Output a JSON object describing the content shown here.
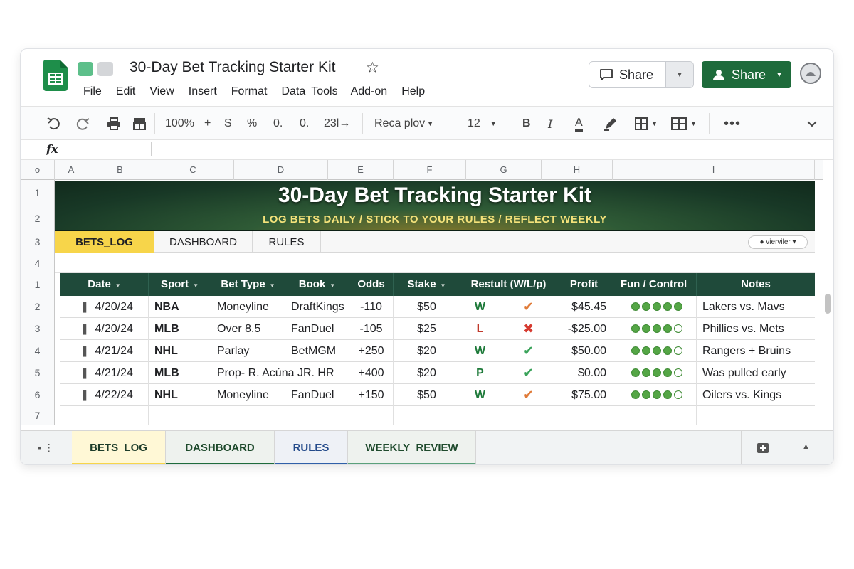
{
  "document": {
    "title": "30-Day Bet Tracking Starter Kit",
    "star_icon": "star-icon"
  },
  "menu": [
    "File",
    "Edit",
    "View",
    "Insert",
    "Format",
    "Data",
    "Tools",
    "Add-on",
    "Help"
  ],
  "share": {
    "outline_label": "Share",
    "primary_label": "Share"
  },
  "toolbar": {
    "zoom": "100%",
    "plus": "+",
    "currency": "S",
    "percent": "%",
    "decimal_less": "0.",
    "decimal_more": "0.",
    "format_more": "23l→",
    "font": "Reca plov",
    "font_size": "12",
    "bold": "B",
    "italic": "I",
    "text_color": "A"
  },
  "formula": {
    "fx": "fx",
    "value": ""
  },
  "columns": [
    "A",
    "B",
    "C",
    "D",
    "E",
    "F",
    "G",
    "H",
    "I"
  ],
  "corner": "o",
  "rows_top": [
    "1",
    "2",
    "3",
    "4"
  ],
  "banner": {
    "title": "30-Day Bet Tracking Starter Kit",
    "subtitle": "LOG BETS DAILY / STICK TO YOUR RULES / REFLECT WEEKLY"
  },
  "inner_tabs": [
    "BETS_LOG",
    "DASHBOARD",
    "RULES"
  ],
  "viewer_chip": "vierviler",
  "table": {
    "headers": [
      "Date",
      "Sport",
      "Bet Type",
      "Book",
      "Odds",
      "Stake",
      "Restult (W/L/p)",
      "Profit",
      "Fun / Control",
      "Notes"
    ],
    "row_numbers": [
      "1",
      "2",
      "3",
      "4",
      "5",
      "6",
      "7"
    ],
    "rows": [
      {
        "date": "4/20/24",
        "sport": "NBA",
        "bet_type": "Moneyline",
        "book": "DraftKings",
        "odds": "-110",
        "stake": "$50",
        "result": "W",
        "mark": "✔",
        "profit": "$45.45",
        "fun": 5,
        "notes": "Lakers vs. Mavs"
      },
      {
        "date": "4/20/24",
        "sport": "MLB",
        "bet_type": "Over 8.5",
        "book": "FanDuel",
        "odds": "-105",
        "stake": "$25",
        "result": "L",
        "mark": "✖",
        "profit": "-$25.00",
        "fun": 4,
        "notes": "Phillies vs. Mets"
      },
      {
        "date": "4/21/24",
        "sport": "NHL",
        "bet_type": "Parlay",
        "book": "BetMGM",
        "odds": "+250",
        "stake": "$20",
        "result": "W",
        "mark": "✔",
        "profit": "$50.00",
        "fun": 4,
        "notes": "Rangers + Bruins"
      },
      {
        "date": "4/21/24",
        "sport": "MLB",
        "bet_type": "Prop- R. Acúna JR. HR",
        "book": "",
        "odds": "+400",
        "stake": "$20",
        "result": "P",
        "mark": "✔",
        "profit": "$0.00",
        "fun": 4,
        "notes": "Was pulled early"
      },
      {
        "date": "4/22/24",
        "sport": "NHL",
        "bet_type": "Moneyline",
        "book": "FanDuel",
        "odds": "+150",
        "stake": "$50",
        "result": "W",
        "mark": "✔",
        "profit": "$75.00",
        "fun": 4,
        "notes": "Oilers vs. Kings"
      }
    ]
  },
  "mark_colors": [
    "#e07b39",
    "#d63a2f",
    "#3aa35a",
    "#3aa35a",
    "#e07b39"
  ],
  "sheet_tabs": [
    {
      "label": "BETS_LOG",
      "color": "#f7d54a",
      "text": "#1e3d2a",
      "bg": "#fff8d6"
    },
    {
      "label": "DASHBOARD",
      "color": "#1e6b3b",
      "text": "#1e4a2c",
      "bg": "#eef2ee"
    },
    {
      "label": "RULES",
      "color": "#2f5fa8",
      "text": "#234a8a",
      "bg": "#eef1f6"
    },
    {
      "label": "WEEKLY_REVIEW",
      "color": "#5aa07a",
      "text": "#1e4a2c",
      "bg": "#eef2ee"
    }
  ],
  "colors": {
    "brand_green": "#1e6b3b",
    "header_green": "#1f4a3a",
    "accent_yellow": "#f7d54a"
  }
}
